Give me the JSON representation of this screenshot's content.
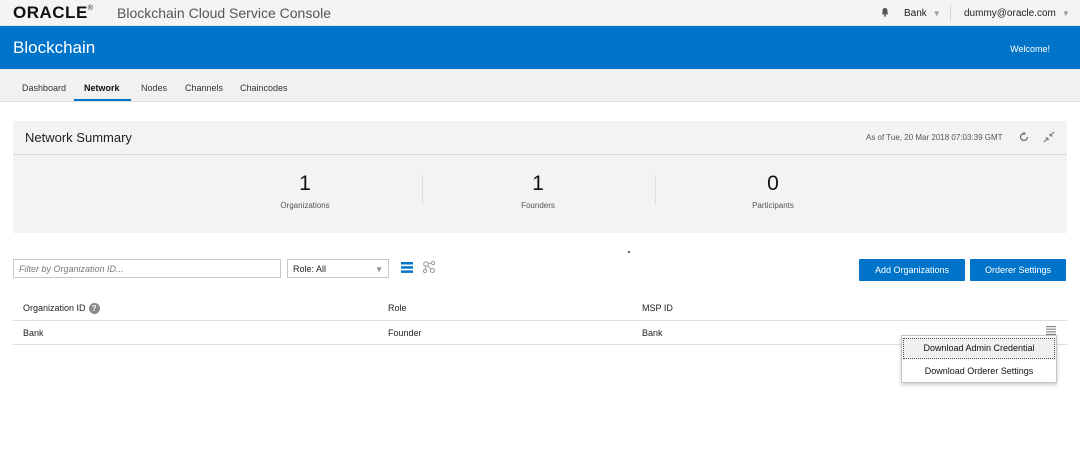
{
  "topbar": {
    "logo": "ORACLE",
    "logo_mark": "®",
    "product": "Blockchain Cloud Service Console",
    "org": "Bank",
    "user": "dummy@oracle.com",
    "caret": "▼"
  },
  "header": {
    "title": "Blockchain",
    "welcome": "Welcome!"
  },
  "nav": {
    "tabs": [
      {
        "label": "Dashboard"
      },
      {
        "label": "Network"
      },
      {
        "label": "Nodes"
      },
      {
        "label": "Channels"
      },
      {
        "label": "Chaincodes"
      }
    ],
    "active": "Network"
  },
  "summary": {
    "title": "Network Summary",
    "as_of": "As of Tue, 20 Mar 2018 07:03:39 GMT",
    "metrics": [
      {
        "value": "1",
        "label": "Organizations"
      },
      {
        "value": "1",
        "label": "Founders"
      },
      {
        "value": "0",
        "label": "Participants"
      }
    ]
  },
  "toolbar": {
    "filter_placeholder": "Filter by Organization ID...",
    "role_value": "Role: All",
    "add_button": "Add Organizations",
    "orderer_button": "Orderer Settings"
  },
  "table": {
    "columns": [
      "Organization ID",
      "Role",
      "MSP ID"
    ],
    "help_glyph": "?",
    "rows": [
      {
        "org_id": "Bank",
        "role": "Founder",
        "msp_id": "Bank"
      }
    ]
  },
  "menu": {
    "items": [
      "Download Admin Credential",
      "Download Orderer Settings"
    ]
  },
  "colors": {
    "brand_blue": "#0074c8",
    "panel_gray": "#f3f3f3"
  }
}
